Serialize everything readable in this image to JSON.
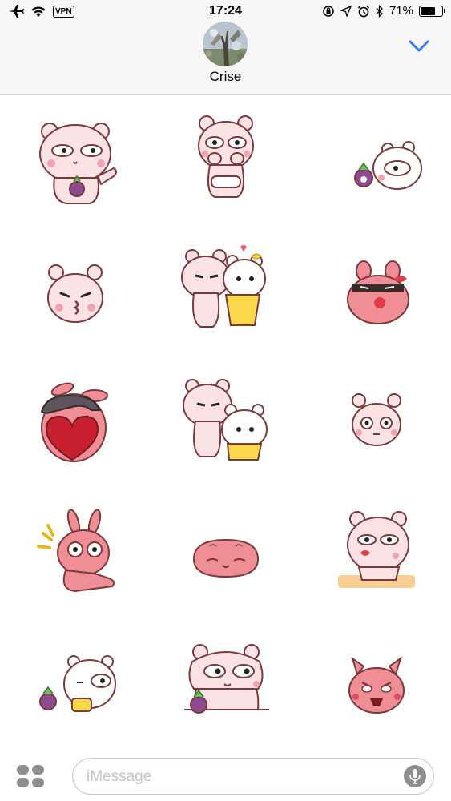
{
  "status_bar": {
    "carrier_badge": "VPN",
    "time": "17:24",
    "battery_percent": "71%",
    "battery_level": 0.71,
    "icons": [
      "airplane-icon",
      "wifi-icon",
      "orientation-lock-icon",
      "location-icon",
      "alarm-icon",
      "bluetooth-icon",
      "battery-icon"
    ]
  },
  "header": {
    "contact_name": "Crise",
    "collapse_icon": "chevron-down-icon"
  },
  "stickers": [
    {
      "name": "bear-holding-mangosteen-waving"
    },
    {
      "name": "bear-hands-on-cheeks"
    },
    {
      "name": "white-bunny-with-mangosteen"
    },
    {
      "name": "bear-kissing-face"
    },
    {
      "name": "bear-and-white-bunny-hug"
    },
    {
      "name": "angry-blob-bunny"
    },
    {
      "name": "bunny-with-heart-and-hair"
    },
    {
      "name": "bear-hugging-bunny"
    },
    {
      "name": "surprised-bear-face"
    },
    {
      "name": "shocked-pink-bunny"
    },
    {
      "name": "sleepy-pink-blob"
    },
    {
      "name": "bear-blowing-kiss-at-table"
    },
    {
      "name": "bunny-eating-with-mangosteen"
    },
    {
      "name": "bear-peeking-with-mangosteen"
    },
    {
      "name": "angry-shouting-bunny"
    }
  ],
  "composer": {
    "placeholder": "iMessage",
    "apps_icon": "app-drawer-icon",
    "mic_icon": "microphone-icon"
  },
  "colors": {
    "accent": "#2f7cf6",
    "bear_pink": "#fbe3e5",
    "bunny_pink": "#ef8f95",
    "outline": "#7a3a3c"
  }
}
